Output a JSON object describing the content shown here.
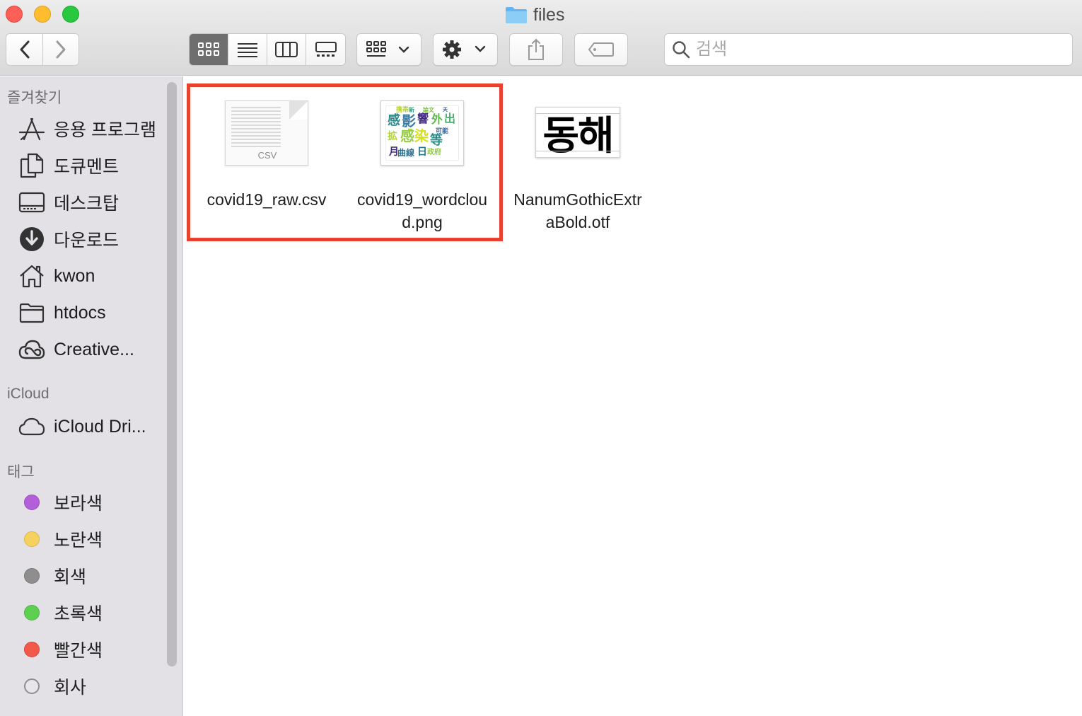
{
  "window": {
    "title": "files"
  },
  "toolbar": {
    "search_placeholder": "검색",
    "icons": {
      "back": "chevron-left-icon",
      "forward": "chevron-right-icon",
      "icon_view": "grid-icon",
      "list_view": "list-icon",
      "column_view": "columns-icon",
      "gallery_view": "gallery-icon",
      "group": "group-icon",
      "action": "gear-icon",
      "share": "share-icon",
      "tag": "tag-icon"
    }
  },
  "sidebar": {
    "favorites_header": "즐겨찾기",
    "favorites": [
      {
        "label": "응용 프로그램",
        "icon": "applications-icon"
      },
      {
        "label": "도큐멘트",
        "icon": "documents-icon"
      },
      {
        "label": "데스크탑",
        "icon": "desktop-icon"
      },
      {
        "label": "다운로드",
        "icon": "downloads-icon"
      },
      {
        "label": "kwon",
        "icon": "home-icon"
      },
      {
        "label": "htdocs",
        "icon": "folder-icon"
      },
      {
        "label": "Creative...",
        "icon": "creative-cloud-icon"
      }
    ],
    "icloud_header": "iCloud",
    "icloud": [
      {
        "label": "iCloud Dri...",
        "icon": "cloud-icon"
      }
    ],
    "tags_header": "태그",
    "tags": [
      {
        "label": "보라색",
        "color": "#b25fd9"
      },
      {
        "label": "노란색",
        "color": "#f5d25f"
      },
      {
        "label": "회색",
        "color": "#8e8e8e"
      },
      {
        "label": "초록색",
        "color": "#5fcf52"
      },
      {
        "label": "빨간색",
        "color": "#f2594b"
      },
      {
        "label": "회사",
        "color": "#e8e6ea"
      }
    ]
  },
  "files": [
    {
      "name_line1": "covid19_raw.csv",
      "name_line2": "",
      "thumb_label": "CSV",
      "kind": "csv"
    },
    {
      "name_line1": "covid19_wordclou",
      "name_line2": "d.png",
      "kind": "png"
    },
    {
      "name_line1": "NanumGothicExtr",
      "name_line2": "aBold.otf",
      "preview_text": "동해",
      "kind": "font"
    }
  ],
  "wordcloud_words": [
    {
      "t": "携帯",
      "c": "#b6d22a"
    },
    {
      "t": "新",
      "c": "#3b9d8a"
    },
    {
      "t": "論文",
      "c": "#7fc241"
    },
    {
      "t": "天",
      "c": "#3a5f8e"
    },
    {
      "t": "感",
      "c": "#2a8a8b"
    },
    {
      "t": "影",
      "c": "#3c7da0"
    },
    {
      "t": "響",
      "c": "#43288a"
    },
    {
      "t": "外",
      "c": "#5fb94c"
    },
    {
      "t": "出",
      "c": "#4bb06f"
    },
    {
      "t": "可能",
      "c": "#35608d"
    },
    {
      "t": "感",
      "c": "#94cf3c"
    },
    {
      "t": "染",
      "c": "#d6df22"
    },
    {
      "t": "等",
      "c": "#2f8c8a"
    },
    {
      "t": "月",
      "c": "#41287e"
    },
    {
      "t": "曲線",
      "c": "#2f6f8e"
    },
    {
      "t": "日",
      "c": "#25778e"
    },
    {
      "t": "政府",
      "c": "#8ccd42"
    },
    {
      "t": "拡",
      "c": "#b2d530"
    }
  ]
}
